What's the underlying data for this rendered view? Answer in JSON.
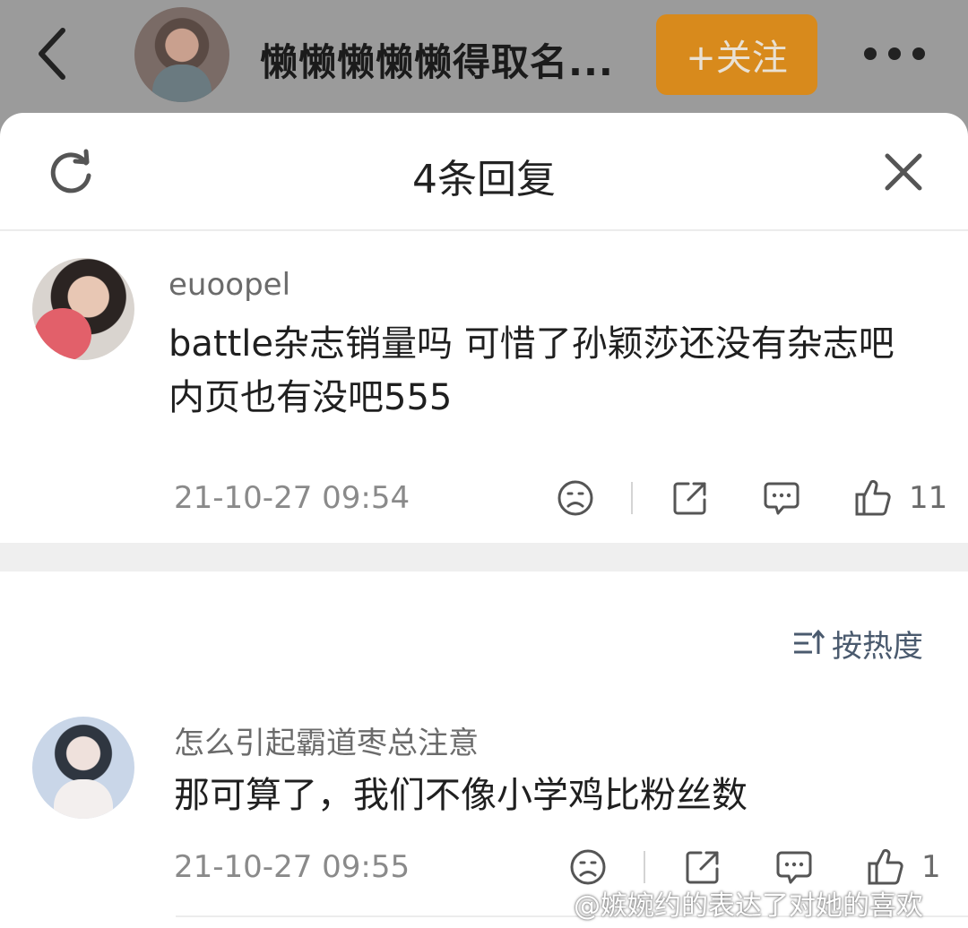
{
  "header": {
    "user_name": "懒懒懒懒懒得取名...",
    "follow_label": "+关注"
  },
  "sheet": {
    "title": "4条回复"
  },
  "comments": [
    {
      "username": "euoopel",
      "text": "battle杂志销量吗 可惜了孙颖莎还没有杂志吧 内页也有没吧555",
      "timestamp": "21-10-27 09:54",
      "likes": "11"
    },
    {
      "username": "怎么引起霸道枣总注意",
      "text": "那可算了，我们不像小学鸡比粉丝数",
      "timestamp": "21-10-27 09:55",
      "likes": "1"
    }
  ],
  "sort": {
    "label": "按热度"
  },
  "watermark": "@嫉婉约的表达了对她的喜欢",
  "icons": [
    "back-icon",
    "more-icon",
    "refresh-icon",
    "close-icon",
    "sad-face-icon",
    "share-icon",
    "reply-icon",
    "thumbs-up-icon",
    "sort-icon"
  ],
  "colors": {
    "follow_button": "#d88a1c",
    "sort_label": "#4a5a6e",
    "overlay": "#9b9b9b"
  }
}
